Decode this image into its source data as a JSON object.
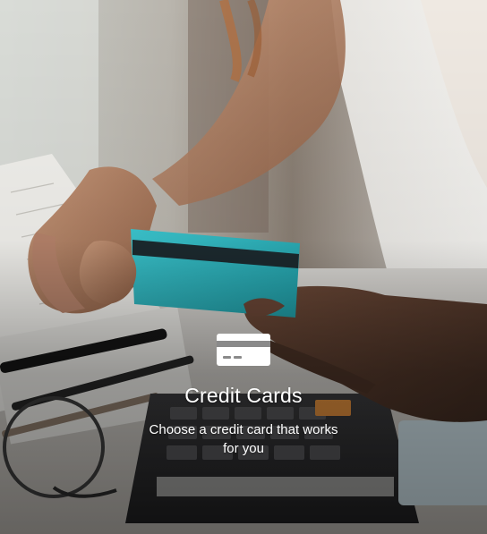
{
  "tile": {
    "title": "Credit Cards",
    "subtitle": "Choose a credit card that works for you",
    "icon": "credit-card-icon",
    "text_color": "#ffffff",
    "card_color": "#2bb5be"
  }
}
